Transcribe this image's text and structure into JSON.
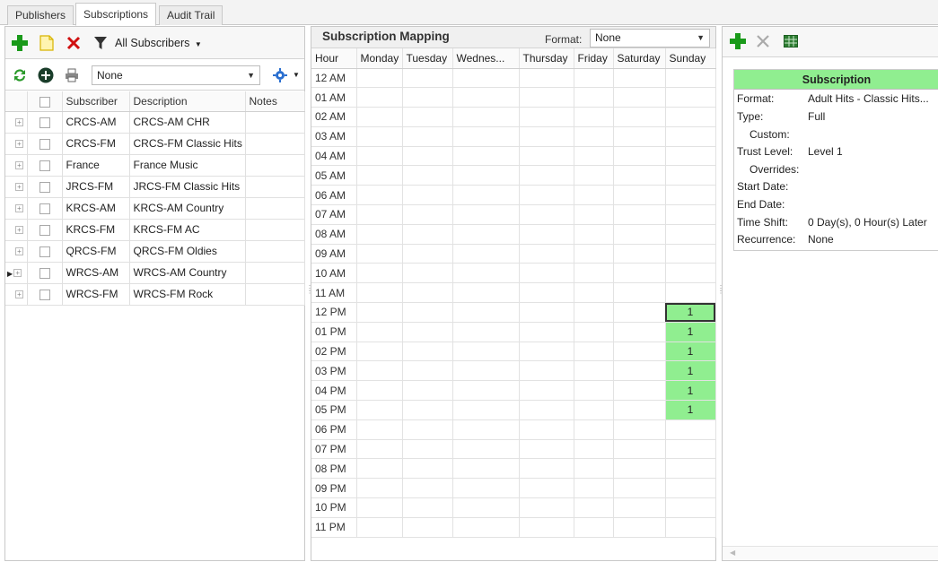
{
  "tabs": [
    "Publishers",
    "Subscriptions",
    "Audit Trail"
  ],
  "left": {
    "filter_label": "All Subscribers",
    "combo_value": "None",
    "columns": [
      "Subscriber",
      "Description",
      "Notes"
    ],
    "rows": [
      {
        "subscriber": "CRCS-AM",
        "description": "CRCS-AM CHR",
        "notes": ""
      },
      {
        "subscriber": "CRCS-FM",
        "description": "CRCS-FM Classic Hits",
        "notes": ""
      },
      {
        "subscriber": "France",
        "description": "France Music",
        "notes": ""
      },
      {
        "subscriber": "JRCS-FM",
        "description": "JRCS-FM Classic Hits",
        "notes": ""
      },
      {
        "subscriber": "KRCS-AM",
        "description": "KRCS-AM Country",
        "notes": ""
      },
      {
        "subscriber": "KRCS-FM",
        "description": "KRCS-FM AC",
        "notes": ""
      },
      {
        "subscriber": "QRCS-FM",
        "description": "QRCS-FM Oldies",
        "notes": ""
      },
      {
        "subscriber": "WRCS-AM",
        "description": "WRCS-AM Country",
        "notes": ""
      },
      {
        "subscriber": "WRCS-FM",
        "description": "WRCS-FM Rock",
        "notes": ""
      }
    ]
  },
  "mapping": {
    "title": "Subscription Mapping",
    "format_label": "Format:",
    "format_value": "None",
    "columns": [
      "Hour",
      "Monday",
      "Tuesday",
      "Wednes...",
      "Thursday",
      "Friday",
      "Saturday",
      "Sunday"
    ],
    "hours": [
      "12 AM",
      "01 AM",
      "02 AM",
      "03 AM",
      "04 AM",
      "05 AM",
      "06 AM",
      "07 AM",
      "08 AM",
      "09 AM",
      "10 AM",
      "11 AM",
      "12 PM",
      "01 PM",
      "02 PM",
      "03 PM",
      "04 PM",
      "05 PM",
      "06 PM",
      "07 PM",
      "08 PM",
      "09 PM",
      "10 PM",
      "11 PM"
    ],
    "cells": [
      {
        "hour": "12 PM",
        "day": "Sunday",
        "value": "1",
        "selected": true
      },
      {
        "hour": "01 PM",
        "day": "Sunday",
        "value": "1"
      },
      {
        "hour": "02 PM",
        "day": "Sunday",
        "value": "1"
      },
      {
        "hour": "03 PM",
        "day": "Sunday",
        "value": "1"
      },
      {
        "hour": "04 PM",
        "day": "Sunday",
        "value": "1"
      },
      {
        "hour": "05 PM",
        "day": "Sunday",
        "value": "1"
      }
    ],
    "highlight_color": "#90ee90"
  },
  "subscription": {
    "header": "Subscription",
    "header_color": "#90ee90",
    "format_label": "Format:",
    "format_value": "Adult Hits - Classic Hits...",
    "type_label": "Type:",
    "type_value": "Full",
    "custom_label": "Custom:",
    "trust_label": "Trust Level:",
    "trust_value": "Level 1",
    "overrides_label": "Overrides:",
    "start_label": "Start Date:",
    "end_label": "End Date:",
    "timeshift_label": "Time Shift:",
    "timeshift_value": "0 Day(s), 0 Hour(s) Later",
    "recurrence_label": "Recurrence:",
    "recurrence_value": "None"
  }
}
